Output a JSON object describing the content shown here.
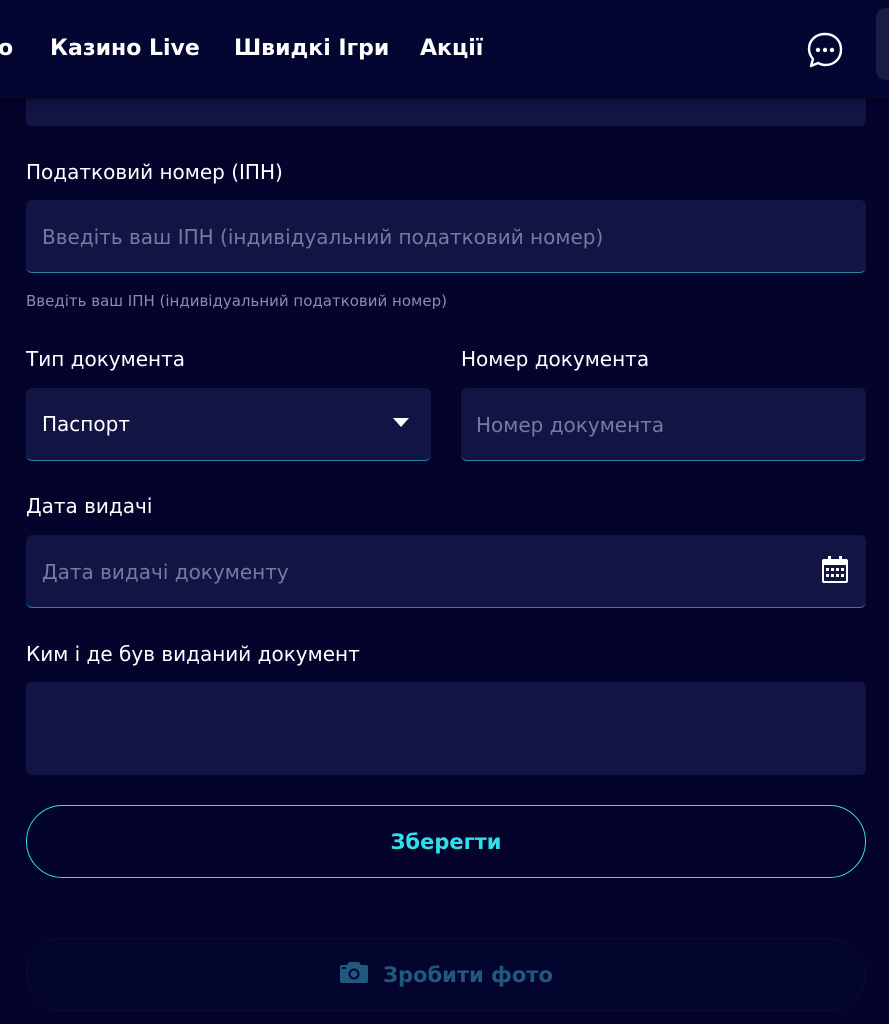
{
  "nav": {
    "partial_item": "о",
    "items": [
      {
        "label": "Казино Live"
      },
      {
        "label": "Швидкі Ігри"
      },
      {
        "label": "Акції"
      }
    ],
    "chat_icon": "chat-bubble-icon"
  },
  "form": {
    "tax_number": {
      "label": "Податковий номер (ІПН)",
      "placeholder": "Введіть ваш ІПН (індивідуальний податковий номер)",
      "hint": "Введіть ваш ІПН (індивідуальний податковий номер)"
    },
    "document_type": {
      "label": "Тип документа",
      "value": "Паспорт"
    },
    "document_number": {
      "label": "Номер документа",
      "placeholder": "Номер документа"
    },
    "issue_date": {
      "label": "Дата видачі",
      "placeholder": "Дата видачі документу",
      "icon": "calendar-icon"
    },
    "issued_by": {
      "label": "Ким і де був виданий документ",
      "value": ""
    }
  },
  "actions": {
    "save_label": "Зберегти",
    "photo_label": "Зробити фото",
    "photo_icon": "camera-icon"
  },
  "colors": {
    "background": "#03032b",
    "field": "#121543",
    "accent": "#2fe0ea"
  }
}
